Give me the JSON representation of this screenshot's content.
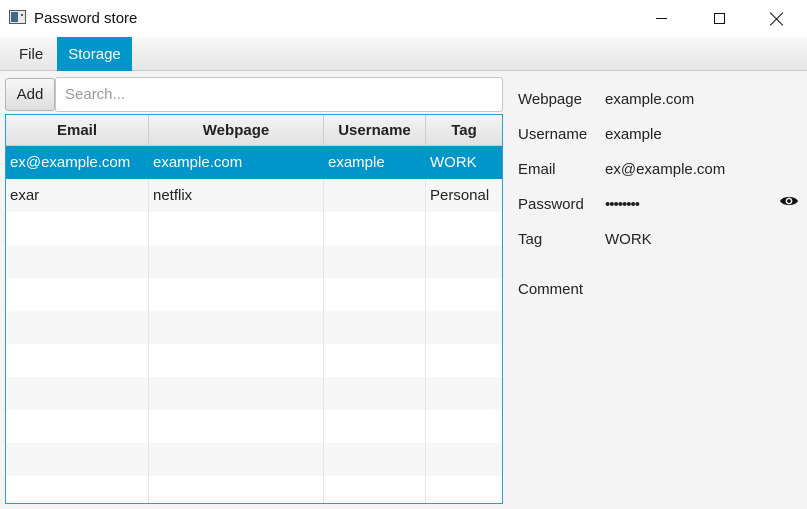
{
  "window": {
    "title": "Password store"
  },
  "menu": {
    "items": [
      "File",
      "Storage"
    ],
    "active": "Storage"
  },
  "toolbar": {
    "add_label": "Add",
    "search_placeholder": "Search...",
    "search_value": ""
  },
  "table": {
    "columns": [
      "Email",
      "Webpage",
      "Username",
      "Tag"
    ],
    "rows": [
      {
        "email": "ex@example.com",
        "webpage": "example.com",
        "username": "example",
        "tag": "WORK",
        "selected": true
      },
      {
        "email": "exar",
        "webpage": "netflix",
        "username": "",
        "tag": "Personal",
        "selected": false
      }
    ]
  },
  "details": {
    "webpage_label": "Webpage",
    "webpage_value": "example.com",
    "username_label": "Username",
    "username_value": "example",
    "email_label": "Email",
    "email_value": "ex@example.com",
    "password_label": "Password",
    "password_value": "••••••••",
    "tag_label": "Tag",
    "tag_value": "WORK",
    "comment_label": "Comment",
    "comment_value": "",
    "reveal_icon": "eye-icon"
  },
  "colors": {
    "accent": "#0096c9",
    "table_border": "#2b9bd3"
  }
}
